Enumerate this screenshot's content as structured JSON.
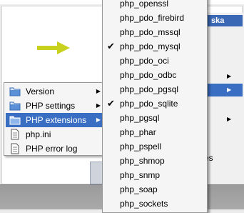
{
  "background_menu": {
    "title_fragment": "ska",
    "tail_fragment": "es"
  },
  "context_menu": {
    "items": [
      {
        "label": "Version",
        "icon": "folder-icon",
        "has_submenu": true
      },
      {
        "label": "PHP settings",
        "icon": "folder-icon",
        "has_submenu": true
      },
      {
        "label": "PHP extensions",
        "icon": "folder-icon",
        "has_submenu": true,
        "highlighted": true
      },
      {
        "label": "php.ini",
        "icon": "document-icon",
        "has_submenu": false
      },
      {
        "label": "PHP error log",
        "icon": "document-icon",
        "has_submenu": false
      }
    ]
  },
  "extensions_menu": {
    "items": [
      {
        "label": "php_openssl",
        "checked": false
      },
      {
        "label": "php_pdo_firebird",
        "checked": false
      },
      {
        "label": "php_pdo_mssql",
        "checked": false
      },
      {
        "label": "php_pdo_mysql",
        "checked": true
      },
      {
        "label": "php_pdo_oci",
        "checked": false
      },
      {
        "label": "php_pdo_odbc",
        "checked": false
      },
      {
        "label": "php_pdo_pgsql",
        "checked": false
      },
      {
        "label": "php_pdo_sqlite",
        "checked": true
      },
      {
        "label": "php_pgsql",
        "checked": false
      },
      {
        "label": "php_phar",
        "checked": false
      },
      {
        "label": "php_pspell",
        "checked": false
      },
      {
        "label": "php_shmop",
        "checked": false
      },
      {
        "label": "php_snmp",
        "checked": false
      },
      {
        "label": "php_soap",
        "checked": false
      },
      {
        "label": "php_sockets",
        "checked": false
      }
    ],
    "check_glyph": "✔"
  },
  "colors": {
    "highlight": "#3a6ec3",
    "arrow": "#c8d21e",
    "folder": "#3b6fb6"
  }
}
